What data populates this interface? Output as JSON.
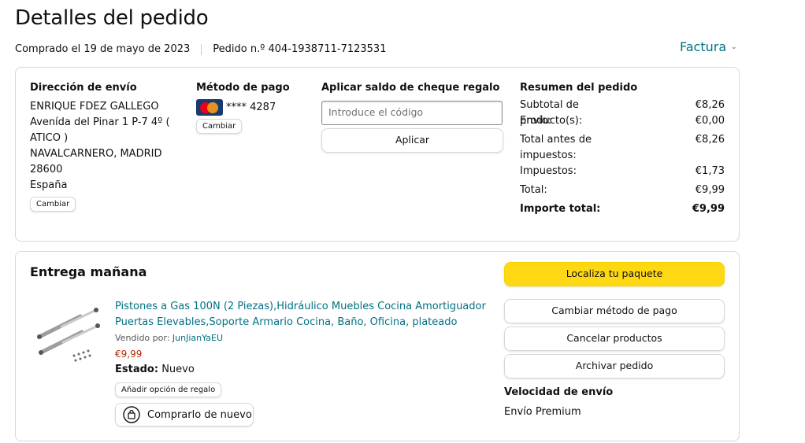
{
  "page": {
    "title": "Detalles del pedido",
    "purchased": "Comprado el 19 de mayo de 2023",
    "order_number": "Pedido n.º 404-1938711-7123531",
    "invoice_label": "Factura"
  },
  "shipping": {
    "heading": "Dirección de envío",
    "name": "ENRIQUE FDEZ GALLEGO",
    "address_line1": "Avenída del Pinar 1 P-7 4º (",
    "address_line2": "ATICO )",
    "city": "NAVALCARNERO, MADRID",
    "postal_code": "28600",
    "country": "España",
    "change_label": "Cambiar"
  },
  "payment": {
    "heading": "Método de pago",
    "card_masked": "**** 4287",
    "change_label": "Cambiar"
  },
  "gift": {
    "heading": "Aplicar saldo de cheque regalo",
    "placeholder": "Introduce el código",
    "apply_label": "Aplicar"
  },
  "summary": {
    "heading": "Resumen del pedido",
    "rows": [
      {
        "label": "Subtotal de producto(s):",
        "value": "€8,26"
      },
      {
        "label": "Envío:",
        "value": "€0,00"
      },
      {
        "label_line1": "Total antes de",
        "label_line2": "impuestos:",
        "value": "€8,26"
      },
      {
        "label": "Impuestos:",
        "value": "€1,73"
      },
      {
        "label": "Total:",
        "value": "€9,99"
      },
      {
        "label": "Importe total:",
        "value": "€9,99"
      }
    ]
  },
  "delivery": {
    "heading": "Entrega mañana",
    "product_line1": "Pistones a Gas 100N (2 Piezas),Hidráulico Muebles Cocina Amortiguador",
    "product_line2": "Puertas Elevables,Soporte Armario Cocina, Baño, Oficina, plateado",
    "sold_by_label": "Vendido por:",
    "seller": "JunJianYaEU",
    "price": "€9,99",
    "condition_label": "Estado:",
    "condition_value": "Nuevo",
    "gift_option_label": "Añadir opción de regalo",
    "buy_again_label": "Comprarlo de nuevo",
    "track_label": "Localiza tu paquete",
    "change_payment_label": "Cambiar método de pago",
    "cancel_label": "Cancelar productos",
    "archive_label": "Archivar pedido",
    "speed_heading": "Velocidad de envío",
    "speed_value": "Envío Premium"
  },
  "colors": {
    "accent_link": "#007185",
    "button_yellow": "#ffd814",
    "price_red": "#b12704"
  }
}
